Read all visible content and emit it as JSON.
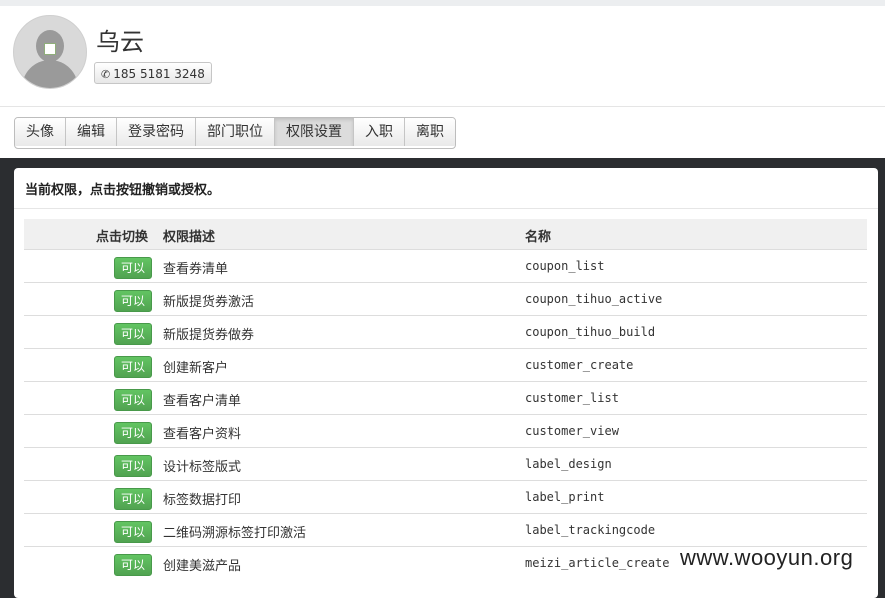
{
  "profile": {
    "name": "乌云",
    "phone": "185 5181 3248",
    "phone_icon": "phone-icon",
    "avatar_icon": "default-avatar"
  },
  "tabs": [
    {
      "label": "头像",
      "active": false
    },
    {
      "label": "编辑",
      "active": false
    },
    {
      "label": "登录密码",
      "active": false
    },
    {
      "label": "部门职位",
      "active": false
    },
    {
      "label": "权限设置",
      "active": true
    },
    {
      "label": "入职",
      "active": false
    },
    {
      "label": "离职",
      "active": false
    }
  ],
  "permissions": {
    "title": "当前权限，点击按钮撤销或授权。",
    "columns": {
      "toggle": "点击切换",
      "description": "权限描述",
      "name": "名称"
    },
    "rows": [
      {
        "button": "可以",
        "description": "查看券清单",
        "name": "coupon_list"
      },
      {
        "button": "可以",
        "description": "新版提货券激活",
        "name": "coupon_tihuo_active"
      },
      {
        "button": "可以",
        "description": "新版提货券做券",
        "name": "coupon_tihuo_build"
      },
      {
        "button": "可以",
        "description": "创建新客户",
        "name": "customer_create"
      },
      {
        "button": "可以",
        "description": "查看客户清单",
        "name": "customer_list"
      },
      {
        "button": "可以",
        "description": "查看客户资料",
        "name": "customer_view"
      },
      {
        "button": "可以",
        "description": "设计标签版式",
        "name": "label_design"
      },
      {
        "button": "可以",
        "description": "标签数据打印",
        "name": "label_print"
      },
      {
        "button": "可以",
        "description": "二维码溯源标签打印激活",
        "name": "label_trackingcode"
      },
      {
        "button": "可以",
        "description": "创建美滋产品",
        "name": "meizi_article_create"
      }
    ],
    "button_color": "#5bb75b"
  },
  "watermark": "www.wooyun.org"
}
